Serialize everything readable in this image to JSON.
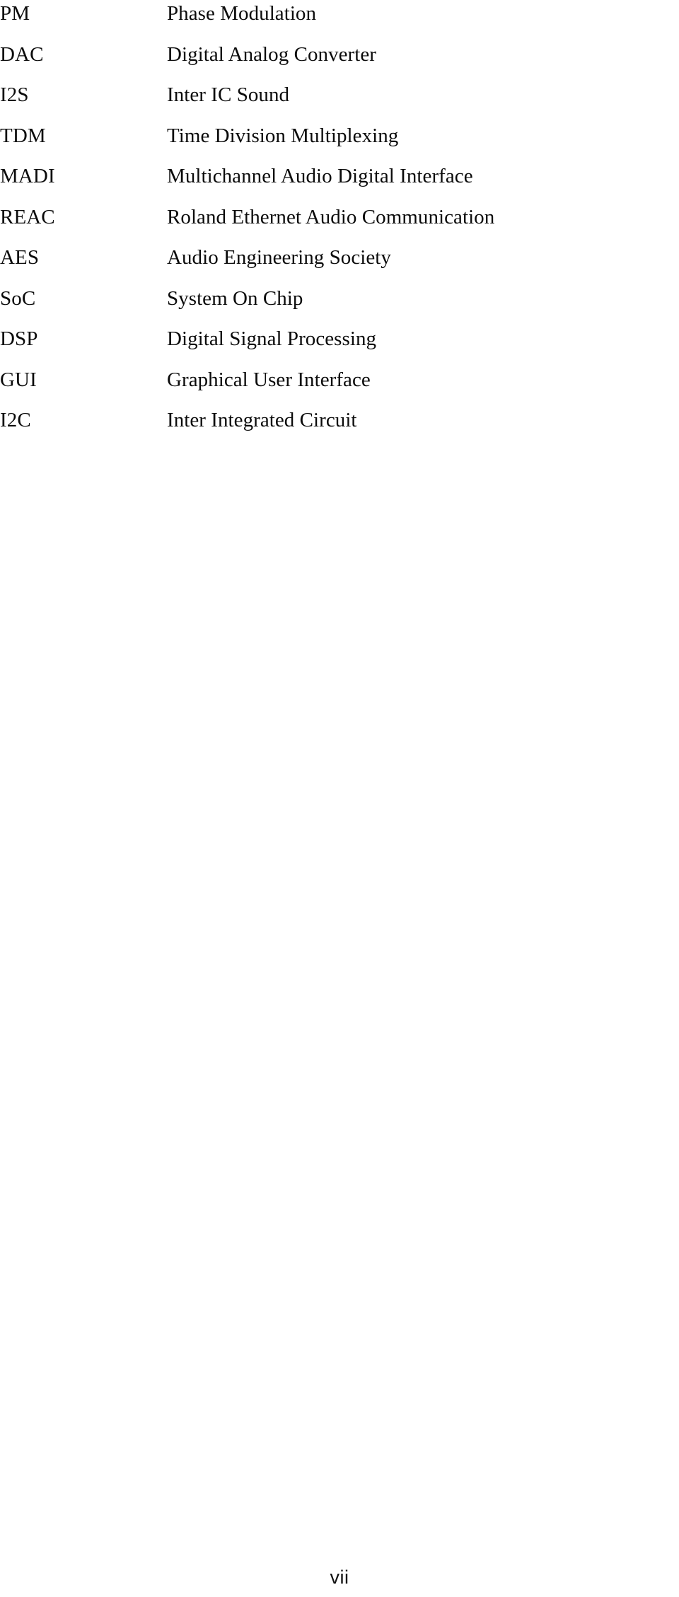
{
  "page": {
    "type": "abbreviations-list",
    "page_number": "vii",
    "background_color": "#ffffff",
    "text_color": "#0b0b0b"
  },
  "abbreviations": [
    {
      "term": "PM",
      "definition": "Phase Modulation"
    },
    {
      "term": "DAC",
      "definition": "Digital Analog Converter"
    },
    {
      "term": "I2S",
      "definition": "Inter IC Sound"
    },
    {
      "term": "TDM",
      "definition": "Time Division Multiplexing"
    },
    {
      "term": "MADI",
      "definition": "Multichannel Audio Digital Interface"
    },
    {
      "term": "REAC",
      "definition": "Roland Ethernet Audio Communication"
    },
    {
      "term": "AES",
      "definition": "Audio Engineering Society"
    },
    {
      "term": "SoC",
      "definition": "System On Chip"
    },
    {
      "term": "DSP",
      "definition": "Digital Signal Processing"
    },
    {
      "term": "GUI",
      "definition": "Graphical User Interface"
    },
    {
      "term": "I2C",
      "definition": "Inter Integrated Circuit"
    }
  ]
}
